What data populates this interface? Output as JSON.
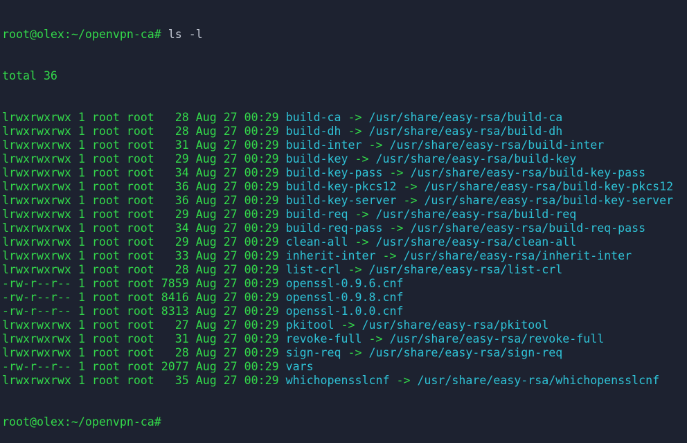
{
  "colors": {
    "background": "#1d2230",
    "green": "#33d94a",
    "cyan": "#2fc2d6",
    "white": "#c5cbd6"
  },
  "prompt_line": {
    "prompt": "root@olex:~/openvpn-ca#",
    "command": " ls -l"
  },
  "total_line": "total 36",
  "entries": [
    {
      "meta": "lrwxrwxrwx 1 root root   28 Aug 27 00:29 ",
      "name": "build-ca",
      "arrow": " -> ",
      "target": "/usr/share/easy-rsa/build-ca"
    },
    {
      "meta": "lrwxrwxrwx 1 root root   28 Aug 27 00:29 ",
      "name": "build-dh",
      "arrow": " -> ",
      "target": "/usr/share/easy-rsa/build-dh"
    },
    {
      "meta": "lrwxrwxrwx 1 root root   31 Aug 27 00:29 ",
      "name": "build-inter",
      "arrow": " -> ",
      "target": "/usr/share/easy-rsa/build-inter"
    },
    {
      "meta": "lrwxrwxrwx 1 root root   29 Aug 27 00:29 ",
      "name": "build-key",
      "arrow": " -> ",
      "target": "/usr/share/easy-rsa/build-key"
    },
    {
      "meta": "lrwxrwxrwx 1 root root   34 Aug 27 00:29 ",
      "name": "build-key-pass",
      "arrow": " -> ",
      "target": "/usr/share/easy-rsa/build-key-pass"
    },
    {
      "meta": "lrwxrwxrwx 1 root root   36 Aug 27 00:29 ",
      "name": "build-key-pkcs12",
      "arrow": " -> ",
      "target": "/usr/share/easy-rsa/build-key-pkcs12"
    },
    {
      "meta": "lrwxrwxrwx 1 root root   36 Aug 27 00:29 ",
      "name": "build-key-server",
      "arrow": " -> ",
      "target": "/usr/share/easy-rsa/build-key-server"
    },
    {
      "meta": "lrwxrwxrwx 1 root root   29 Aug 27 00:29 ",
      "name": "build-req",
      "arrow": " -> ",
      "target": "/usr/share/easy-rsa/build-req"
    },
    {
      "meta": "lrwxrwxrwx 1 root root   34 Aug 27 00:29 ",
      "name": "build-req-pass",
      "arrow": " -> ",
      "target": "/usr/share/easy-rsa/build-req-pass"
    },
    {
      "meta": "lrwxrwxrwx 1 root root   29 Aug 27 00:29 ",
      "name": "clean-all",
      "arrow": " -> ",
      "target": "/usr/share/easy-rsa/clean-all"
    },
    {
      "meta": "lrwxrwxrwx 1 root root   33 Aug 27 00:29 ",
      "name": "inherit-inter",
      "arrow": " -> ",
      "target": "/usr/share/easy-rsa/inherit-inter"
    },
    {
      "meta": "lrwxrwxrwx 1 root root   28 Aug 27 00:29 ",
      "name": "list-crl",
      "arrow": " -> ",
      "target": "/usr/share/easy-rsa/list-crl"
    },
    {
      "meta": "-rw-r--r-- 1 root root 7859 Aug 27 00:29 ",
      "name": "openssl-0.9.6.cnf",
      "arrow": "",
      "target": ""
    },
    {
      "meta": "-rw-r--r-- 1 root root 8416 Aug 27 00:29 ",
      "name": "openssl-0.9.8.cnf",
      "arrow": "",
      "target": ""
    },
    {
      "meta": "-rw-r--r-- 1 root root 8313 Aug 27 00:29 ",
      "name": "openssl-1.0.0.cnf",
      "arrow": "",
      "target": ""
    },
    {
      "meta": "lrwxrwxrwx 1 root root   27 Aug 27 00:29 ",
      "name": "pkitool",
      "arrow": " -> ",
      "target": "/usr/share/easy-rsa/pkitool"
    },
    {
      "meta": "lrwxrwxrwx 1 root root   31 Aug 27 00:29 ",
      "name": "revoke-full",
      "arrow": " -> ",
      "target": "/usr/share/easy-rsa/revoke-full"
    },
    {
      "meta": "lrwxrwxrwx 1 root root   28 Aug 27 00:29 ",
      "name": "sign-req",
      "arrow": " -> ",
      "target": "/usr/share/easy-rsa/sign-req"
    },
    {
      "meta": "-rw-r--r-- 1 root root 2077 Aug 27 00:29 ",
      "name": "vars",
      "arrow": "",
      "target": ""
    },
    {
      "meta": "lrwxrwxrwx 1 root root   35 Aug 27 00:29 ",
      "name": "whichopensslcnf",
      "arrow": " -> ",
      "target": "/usr/share/easy-rsa/whichopensslcnf"
    }
  ],
  "final_prompt": "root@olex:~/openvpn-ca#"
}
